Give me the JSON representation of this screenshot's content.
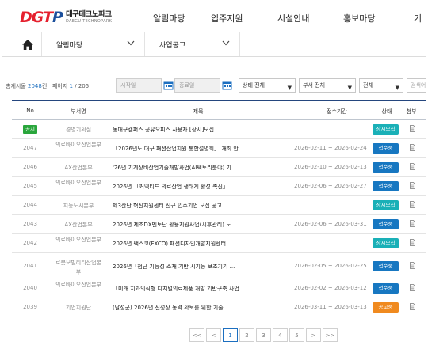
{
  "header": {
    "logo_mark_a": "DGT",
    "logo_mark_b": "P",
    "logo_ko": "대구테크노파크",
    "logo_en": "DAEGU TECHNOPARK",
    "nav": [
      "알림마당",
      "입주지원",
      "시설안내",
      "홍보마당",
      "기"
    ]
  },
  "subnav": {
    "home_icon": "home-icon",
    "menu1": "알림마당",
    "menu2": "사업공고"
  },
  "filters": {
    "total_label": "총게시물",
    "total_count": "2048",
    "total_unit": "건",
    "page_label": "페이지",
    "page_current": "1",
    "page_total": "/ 205",
    "start_placeholder": "시작일",
    "end_placeholder": "종료일",
    "status": "상태 전체",
    "dept": "부서 전체",
    "scope": "전체",
    "search_placeholder": "검색어"
  },
  "table": {
    "headers": [
      "No",
      "부서명",
      "제목",
      "접수기간",
      "상태",
      "첨부"
    ],
    "rows": [
      {
        "no": "공지",
        "dept": "경영기획실",
        "title": "동대구캠퍼스 공유오피스 사용자 [상시]모집",
        "period": "",
        "status": "상시모집"
      },
      {
        "no": "2047",
        "dept": "의료바이오산업본부",
        "title": "「2026년도 대구 패션산업지원 통합설명회」 개최 안...",
        "period": "2026-02-11 ~ 2026-02-24",
        "status": "접수중"
      },
      {
        "no": "2046",
        "dept": "AX산업본부",
        "title": "'26년 기계장비산업기술개발사업(AI팩토리분야) 기...",
        "period": "2026-02-10 ~ 2026-02-13",
        "status": "접수중"
      },
      {
        "no": "2045",
        "dept": "의료바이오산업본부",
        "title": "2026년 「커넥티드 의료산업 생태계 활성 촉진」...",
        "period": "2026-02-06 ~ 2026-02-27",
        "status": "접수중"
      },
      {
        "no": "2044",
        "dept": "지능도시본부",
        "title": "제3산단 혁신지원센터 신규 입주기업 모집 공고",
        "period": "",
        "status": "상시모집"
      },
      {
        "no": "2043",
        "dept": "AX산업본부",
        "title": "2026년 제조DX멘토단 활용지원사업(시후관리) 도...",
        "period": "2026-02-06 ~ 2026-03-31",
        "status": "접수중"
      },
      {
        "no": "2042",
        "dept": "의료바이오산업본부",
        "title": "2026년 팩스코(FXCO) 패션디자인개발지원센터 ...",
        "period": "",
        "status": "상시모집"
      },
      {
        "no": "2041",
        "dept": "로봇모빌리티산업본부",
        "title": "2026년「첨단 기능성 소재 기반 시기능 보조기기 ...",
        "period": "2026-02-05 ~ 2026-02-25",
        "status": "접수중"
      },
      {
        "no": "2040",
        "dept": "의료바이오산업본부",
        "title": "「미래 치과의식형 디지털의료제품 개발 기반구축 사업...",
        "period": "2026-02-02 ~ 2026-03-12",
        "status": "접수중"
      },
      {
        "no": "2039",
        "dept": "기업지원단",
        "title": "(달성군) 2026년 신성장 동력 확보를 위한 기술...",
        "period": "2026-03-11 ~ 2026-03-13",
        "status": "공고중"
      }
    ]
  },
  "pagination": {
    "first": "<<",
    "prev": "<",
    "pages": [
      "1",
      "2",
      "3",
      "4",
      "5"
    ],
    "next": ">",
    "last": ">>"
  },
  "colors": {
    "accent": "#1c6fc0",
    "navy": "#24467e",
    "teal": "#1ab0b7",
    "blue": "#1777c1",
    "orange": "#f08a1f",
    "green": "#2aa63c",
    "logo_red": "#e5202e"
  }
}
